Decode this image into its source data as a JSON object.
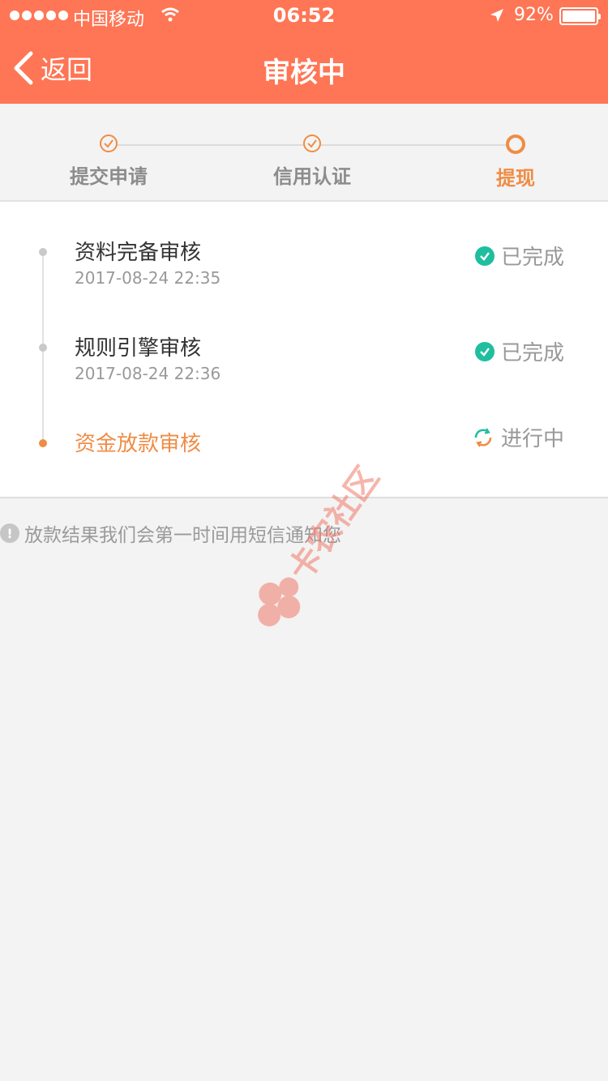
{
  "status_bar": {
    "carrier": "中国移动",
    "time": "06:52",
    "battery": "92%"
  },
  "nav": {
    "back_label": "返回",
    "title": "审核中"
  },
  "steps": [
    {
      "label": "提交申请",
      "state": "done"
    },
    {
      "label": "信用认证",
      "state": "done"
    },
    {
      "label": "提现",
      "state": "current"
    }
  ],
  "timeline": [
    {
      "title": "资料完备审核",
      "time": "2017-08-24 22:35",
      "status": "已完成",
      "state": "done"
    },
    {
      "title": "规则引擎审核",
      "time": "2017-08-24 22:36",
      "status": "已完成",
      "state": "done"
    },
    {
      "title": "资金放款审核",
      "time": "",
      "status": "进行中",
      "state": "in-progress"
    }
  ],
  "notice": "放款结果我们会第一时间用短信通知您",
  "watermark": "卡农社区",
  "colors": {
    "header": "#fe7655",
    "accent": "#f08c45",
    "success": "#1fbe9e",
    "background": "#f3f3f3"
  }
}
